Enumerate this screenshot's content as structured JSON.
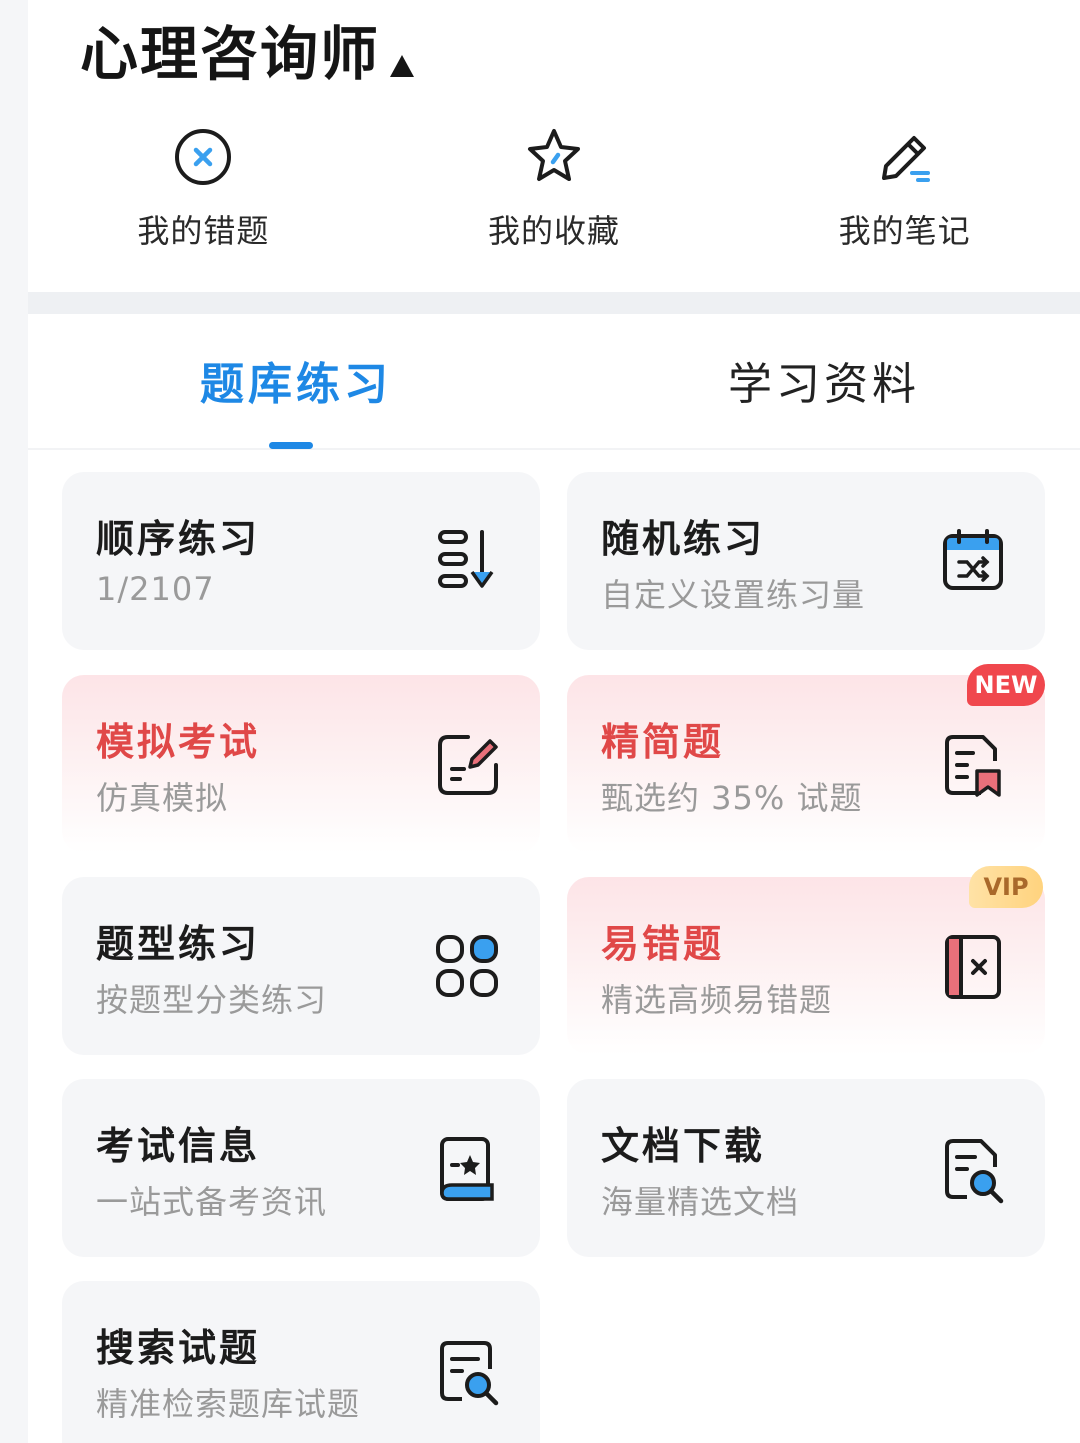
{
  "header": {
    "title": "心理咨询师"
  },
  "quick_actions": [
    {
      "label": "我的错题",
      "icon": "circle-x-icon"
    },
    {
      "label": "我的收藏",
      "icon": "star-icon"
    },
    {
      "label": "我的笔记",
      "icon": "pencil-icon"
    }
  ],
  "tabs": [
    {
      "label": "题库练习",
      "active": true
    },
    {
      "label": "学习资料",
      "active": false
    }
  ],
  "cards": [
    {
      "title": "顺序练习",
      "subtitle": "1/2107",
      "icon": "sort-list-icon"
    },
    {
      "title": "随机练习",
      "subtitle": "自定义设置练习量",
      "icon": "shuffle-calendar-icon"
    },
    {
      "title": "模拟考试",
      "subtitle": "仿真模拟",
      "icon": "edit-note-icon"
    },
    {
      "title": "精简题",
      "subtitle": "甄选约 35% 试题",
      "icon": "bookmark-doc-icon",
      "badge": "NEW"
    },
    {
      "title": "题型练习",
      "subtitle": "按题型分类练习",
      "icon": "grid-icon"
    },
    {
      "title": "易错题",
      "subtitle": "精选高频易错题",
      "icon": "wrong-book-icon",
      "badge": "VIP"
    },
    {
      "title": "考试信息",
      "subtitle": "一站式备考资讯",
      "icon": "star-doc-icon"
    },
    {
      "title": "文档下载",
      "subtitle": "海量精选文档",
      "icon": "search-doc-icon"
    },
    {
      "title": "搜索试题",
      "subtitle": "精准检索题库试题",
      "icon": "search-doc-icon"
    }
  ],
  "colors": {
    "accent": "#1e88e5",
    "highlight_red": "#e04848",
    "icon_blue": "#3aa0ef",
    "new_badge": "#f0474d",
    "vip_badge": "#ffd37e"
  }
}
